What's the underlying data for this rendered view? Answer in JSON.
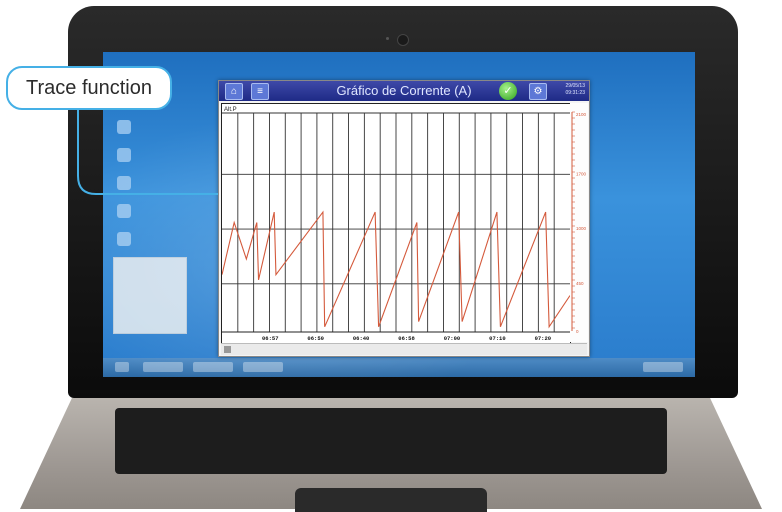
{
  "callout": {
    "label": "Trace function"
  },
  "app": {
    "title": "Gráfico de Corrente (A)",
    "date": "29/05/13",
    "time": "09:31:23",
    "channel_label": "Alt.P"
  },
  "y_ticks": [
    "2100",
    "1700",
    "1000",
    "450",
    "0"
  ],
  "x_ticks": [
    "06:57",
    "06:50",
    "06:40",
    "06:58",
    "07:00",
    "07:10",
    "07:20"
  ],
  "chart_data": {
    "type": "line",
    "title": "Gráfico de Corrente (A)",
    "ylim": [
      0,
      2100
    ],
    "x": [
      "06:57",
      "06:50",
      "06:40",
      "06:58",
      "07:00",
      "07:10",
      "07:20"
    ],
    "series": [
      {
        "color": "#d45a3c",
        "points": [
          [
            0.0,
            550
          ],
          [
            0.035,
            1050
          ],
          [
            0.07,
            700
          ],
          [
            0.1,
            1050
          ],
          [
            0.105,
            500
          ],
          [
            0.15,
            1150
          ],
          [
            0.155,
            550
          ],
          [
            0.29,
            1150
          ],
          [
            0.295,
            50
          ],
          [
            0.44,
            1150
          ],
          [
            0.45,
            50
          ],
          [
            0.56,
            1050
          ],
          [
            0.565,
            100
          ],
          [
            0.68,
            1150
          ],
          [
            0.69,
            100
          ],
          [
            0.79,
            1150
          ],
          [
            0.8,
            50
          ],
          [
            0.93,
            1150
          ],
          [
            0.94,
            50
          ],
          [
            1.0,
            350
          ]
        ]
      }
    ],
    "grid": true
  },
  "colors": {
    "accent": "#45b0e6",
    "trace": "#d45a3c",
    "header": "#1e2a86"
  }
}
